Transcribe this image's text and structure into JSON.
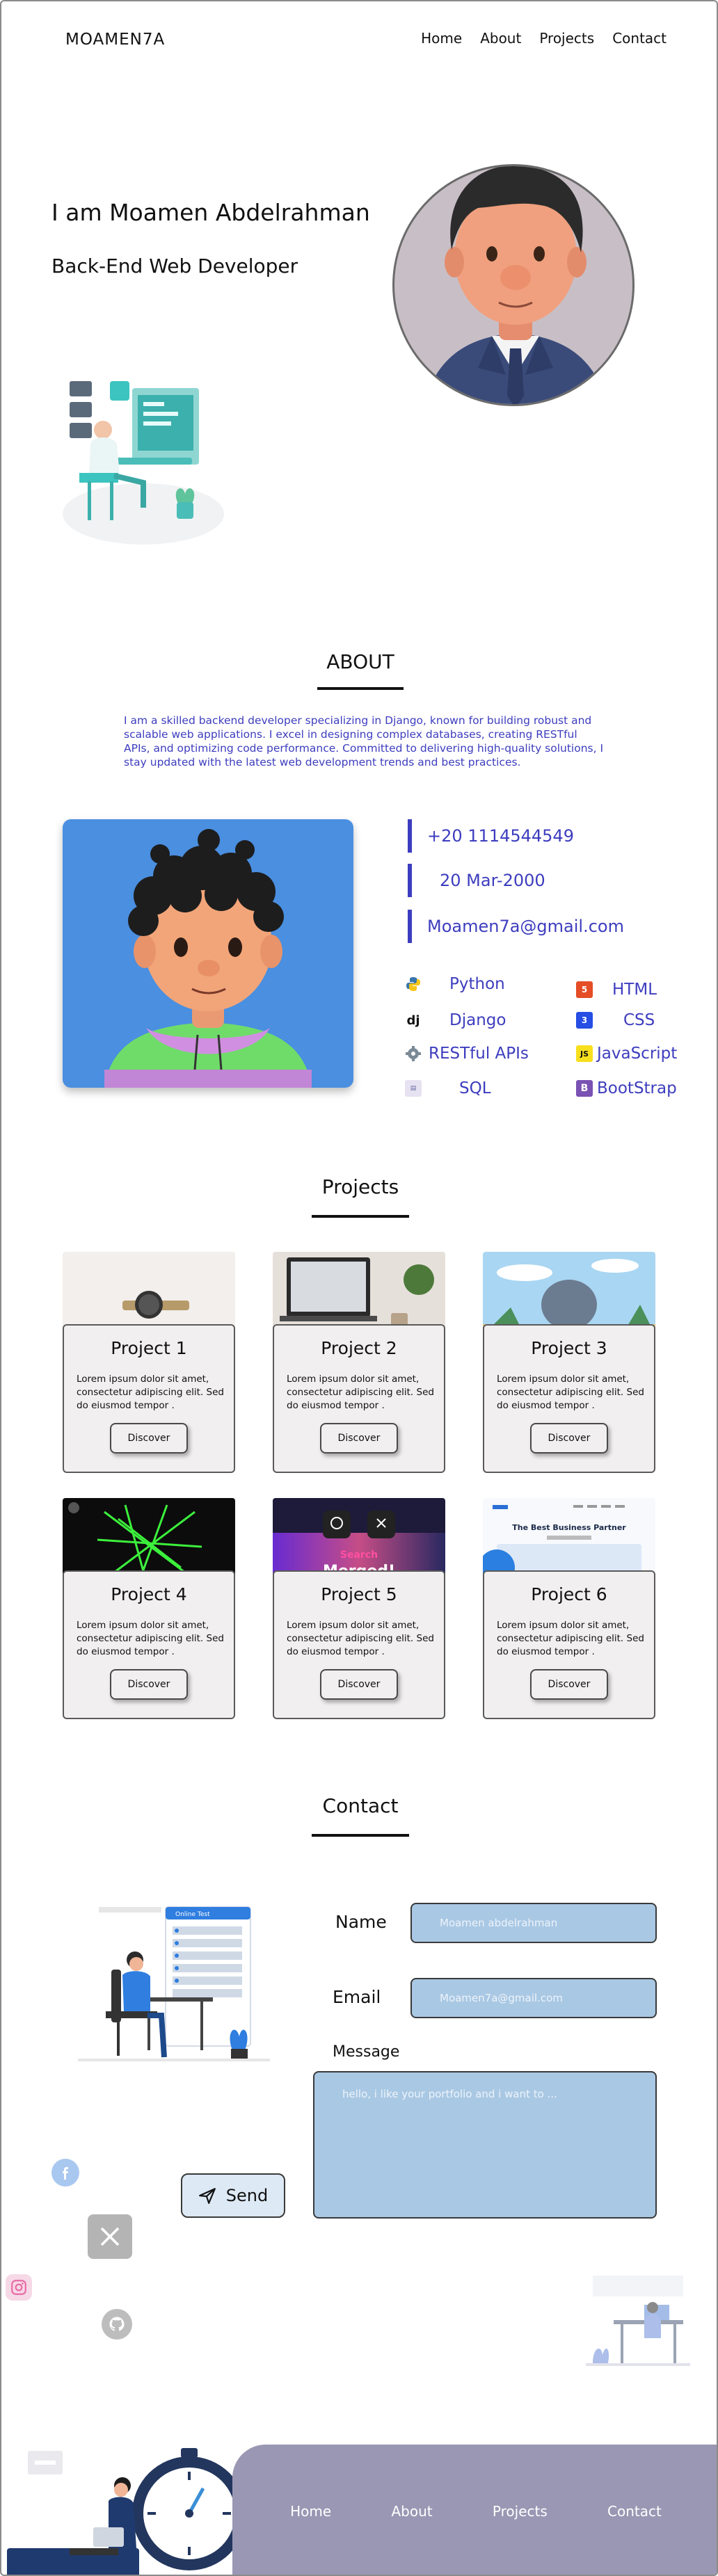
{
  "header": {
    "logo": "MOAMEN7A",
    "nav": [
      "Home",
      "About",
      "Projects",
      "Contact"
    ]
  },
  "hero": {
    "name": "I am Moamen Abdelrahman",
    "role": "Back-End Web Developer"
  },
  "about": {
    "title": "ABOUT",
    "text": "I am a skilled backend developer specializing in Django, known for building robust and scalable web applications. I excel in designing complex databases, creating RESTful APIs, and optimizing code performance. Committed to delivering high-quality solutions, I stay updated with the latest web development trends and best practices.",
    "phone": "+20 1114544549",
    "birthdate": "20 Mar-2000",
    "email": "Moamen7a@gmail.com",
    "skills_left": [
      "Python",
      "Django",
      "RESTful APIs",
      "SQL"
    ],
    "skills_right": [
      "HTML",
      "CSS",
      "JavaScript",
      "BootStrap"
    ]
  },
  "projects": {
    "title": "Projects",
    "items": [
      {
        "title": "Project 1",
        "desc": "Lorem ipsum dolor sit amet, consectetur adipiscing elit. Sed do eiusmod tempor .",
        "button": "Discover"
      },
      {
        "title": "Project 2",
        "desc": "Lorem ipsum dolor sit amet, consectetur adipiscing elit. Sed do eiusmod tempor .",
        "button": "Discover"
      },
      {
        "title": "Project 3",
        "desc": "Lorem ipsum dolor sit amet, consectetur adipiscing elit. Sed do eiusmod tempor .",
        "button": "Discover"
      },
      {
        "title": "Project 4",
        "desc": "Lorem ipsum dolor sit amet, consectetur adipiscing elit. Sed do eiusmod tempor .",
        "button": "Discover"
      },
      {
        "title": "Project 5",
        "desc": "Lorem ipsum dolor sit amet, consectetur adipiscing elit. Sed do eiusmod tempor .",
        "button": "Discover"
      },
      {
        "title": "Project 6",
        "desc": "Lorem ipsum dolor sit amet, consectetur adipiscing elit. Sed do eiusmod tempor .",
        "button": "Discover"
      }
    ],
    "image_texts": {
      "p5_banner_1": "Search",
      "p5_banner_2": "Merged!",
      "p6_headline": "The Best Business Partner"
    }
  },
  "contact": {
    "title": "Contact",
    "name_label": "Name",
    "name_placeholder": "Moamen abdelrahman",
    "email_label": "Email",
    "email_placeholder": "Moamen7a@gmail.com",
    "message_label": "Message",
    "message_placeholder": "hello, i like your portfolio and i want to ...",
    "send_label": "Send",
    "illustration_title": "Online Test"
  },
  "footer": {
    "nav": [
      "Home",
      "About",
      "Projects",
      "Contact"
    ]
  },
  "colors": {
    "accent": "#3d3dbf",
    "photo_bg": "#4a8fe0",
    "field_bg": "#a9c8e4",
    "footer_bg": "#9a97b4"
  },
  "icons": {
    "social": [
      "facebook-icon",
      "x-icon",
      "instagram-icon",
      "github-icon"
    ]
  }
}
